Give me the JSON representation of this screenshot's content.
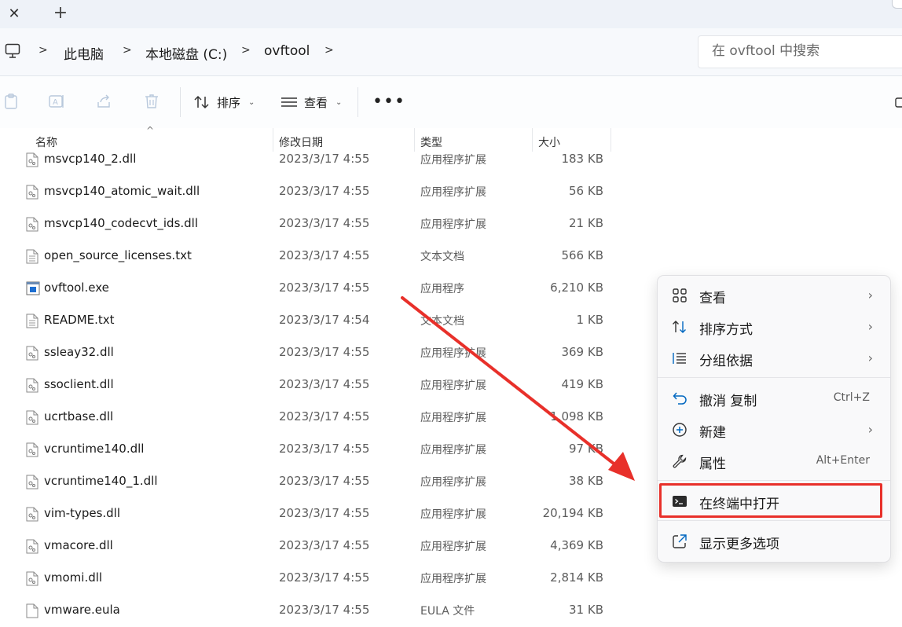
{
  "window": {
    "tab_close_glyph": "✕",
    "tab_new_glyph": "+"
  },
  "address": {
    "crumbs": [
      "此电脑",
      "本地磁盘 (C:)",
      "ovftool"
    ],
    "search_placeholder": "在 ovftool 中搜索"
  },
  "toolbar": {
    "sort_label": "排序",
    "view_label": "查看",
    "more_glyph": "•••"
  },
  "columns": {
    "name": "名称",
    "date": "修改日期",
    "type": "类型",
    "size": "大小"
  },
  "files": [
    {
      "name": "msvcp140_2.dll",
      "date": "2023/3/17 4:55",
      "type": "应用程序扩展",
      "size": "183 KB",
      "icon": "dll-file-icon"
    },
    {
      "name": "msvcp140_atomic_wait.dll",
      "date": "2023/3/17 4:55",
      "type": "应用程序扩展",
      "size": "56 KB",
      "icon": "dll-file-icon"
    },
    {
      "name": "msvcp140_codecvt_ids.dll",
      "date": "2023/3/17 4:55",
      "type": "应用程序扩展",
      "size": "21 KB",
      "icon": "dll-file-icon"
    },
    {
      "name": "open_source_licenses.txt",
      "date": "2023/3/17 4:55",
      "type": "文本文档",
      "size": "566 KB",
      "icon": "text-file-icon"
    },
    {
      "name": "ovftool.exe",
      "date": "2023/3/17 4:55",
      "type": "应用程序",
      "size": "6,210 KB",
      "icon": "exe-file-icon"
    },
    {
      "name": "README.txt",
      "date": "2023/3/17 4:54",
      "type": "文本文档",
      "size": "1 KB",
      "icon": "text-file-icon"
    },
    {
      "name": "ssleay32.dll",
      "date": "2023/3/17 4:55",
      "type": "应用程序扩展",
      "size": "369 KB",
      "icon": "dll-file-icon"
    },
    {
      "name": "ssoclient.dll",
      "date": "2023/3/17 4:55",
      "type": "应用程序扩展",
      "size": "419 KB",
      "icon": "dll-file-icon"
    },
    {
      "name": "ucrtbase.dll",
      "date": "2023/3/17 4:55",
      "type": "应用程序扩展",
      "size": "1,098 KB",
      "icon": "dll-file-icon"
    },
    {
      "name": "vcruntime140.dll",
      "date": "2023/3/17 4:55",
      "type": "应用程序扩展",
      "size": "97 KB",
      "icon": "dll-file-icon"
    },
    {
      "name": "vcruntime140_1.dll",
      "date": "2023/3/17 4:55",
      "type": "应用程序扩展",
      "size": "38 KB",
      "icon": "dll-file-icon"
    },
    {
      "name": "vim-types.dll",
      "date": "2023/3/17 4:55",
      "type": "应用程序扩展",
      "size": "20,194 KB",
      "icon": "dll-file-icon"
    },
    {
      "name": "vmacore.dll",
      "date": "2023/3/17 4:55",
      "type": "应用程序扩展",
      "size": "4,369 KB",
      "icon": "dll-file-icon"
    },
    {
      "name": "vmomi.dll",
      "date": "2023/3/17 4:55",
      "type": "应用程序扩展",
      "size": "2,814 KB",
      "icon": "dll-file-icon"
    },
    {
      "name": "vmware.eula",
      "date": "2023/3/17 4:55",
      "type": "EULA 文件",
      "size": "31 KB",
      "icon": "generic-file-icon"
    }
  ],
  "context_menu": {
    "items": [
      {
        "label": "查看",
        "icon": "grid-view-icon",
        "submenu": true
      },
      {
        "label": "排序方式",
        "icon": "sort-arrows-icon",
        "submenu": true
      },
      {
        "label": "分组依据",
        "icon": "group-list-icon",
        "submenu": true
      },
      {
        "label": "撤消 复制",
        "icon": "undo-icon",
        "shortcut": "Ctrl+Z"
      },
      {
        "label": "新建",
        "icon": "new-plus-icon",
        "submenu": true
      },
      {
        "label": "属性",
        "icon": "wrench-icon",
        "shortcut": "Alt+Enter"
      },
      {
        "label": "在终端中打开",
        "icon": "terminal-icon",
        "highlighted": true
      },
      {
        "label": "显示更多选项",
        "icon": "more-options-icon"
      }
    ],
    "arrow_glyph": "›"
  },
  "colors": {
    "accent": "#0067c0",
    "highlight_red": "#e8302a",
    "menu_bg": "#f9f9fa"
  }
}
